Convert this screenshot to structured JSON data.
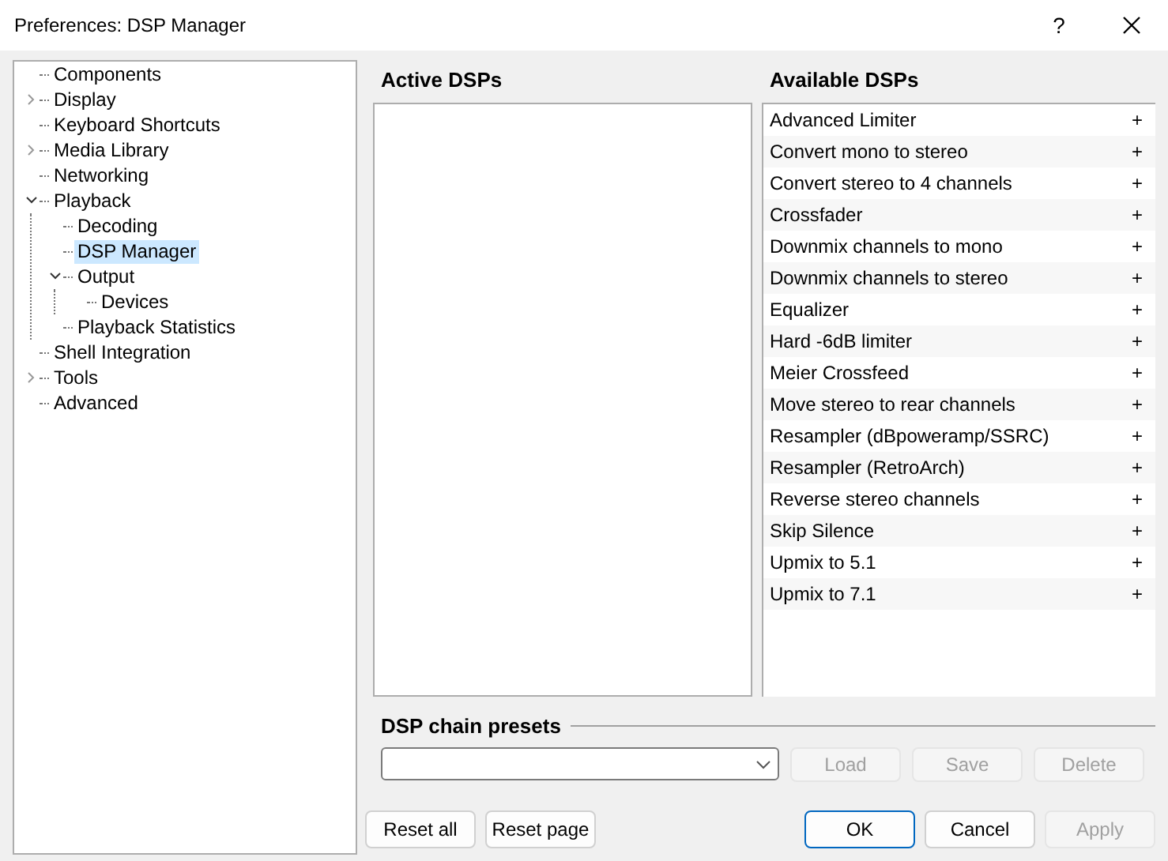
{
  "window": {
    "title": "Preferences: DSP Manager",
    "help": "?"
  },
  "tree": [
    {
      "label": "Components",
      "selected": false
    },
    {
      "label": "Display",
      "selected": false,
      "expanded": false
    },
    {
      "label": "Keyboard Shortcuts",
      "selected": false
    },
    {
      "label": "Media Library",
      "selected": false,
      "expanded": false
    },
    {
      "label": "Networking",
      "selected": false
    },
    {
      "label": "Playback",
      "selected": false,
      "expanded": true,
      "children": [
        {
          "label": "Decoding",
          "selected": false
        },
        {
          "label": "DSP Manager",
          "selected": true
        },
        {
          "label": "Output",
          "selected": false,
          "expanded": true,
          "children": [
            {
              "label": "Devices",
              "selected": false
            }
          ]
        },
        {
          "label": "Playback Statistics",
          "selected": false
        }
      ]
    },
    {
      "label": "Shell Integration",
      "selected": false
    },
    {
      "label": "Tools",
      "selected": false,
      "expanded": false
    },
    {
      "label": "Advanced",
      "selected": false
    }
  ],
  "active_dsps": {
    "title": "Active DSPs"
  },
  "available_dsps": {
    "title": "Available DSPs",
    "items": [
      {
        "label": "Advanced Limiter",
        "action": "+"
      },
      {
        "label": "Convert mono to stereo",
        "action": "+"
      },
      {
        "label": "Convert stereo to 4 channels",
        "action": "+"
      },
      {
        "label": "Crossfader",
        "action": "+"
      },
      {
        "label": "Downmix channels to mono",
        "action": "+"
      },
      {
        "label": "Downmix channels to stereo",
        "action": "+"
      },
      {
        "label": "Equalizer",
        "action": "+"
      },
      {
        "label": "Hard -6dB limiter",
        "action": "+"
      },
      {
        "label": "Meier Crossfeed",
        "action": "+"
      },
      {
        "label": "Move stereo to rear channels",
        "action": "+"
      },
      {
        "label": "Resampler (dBpoweramp/SSRC)",
        "action": "+"
      },
      {
        "label": "Resampler (RetroArch)",
        "action": "+"
      },
      {
        "label": "Reverse stereo channels",
        "action": "+"
      },
      {
        "label": "Skip Silence",
        "action": "+"
      },
      {
        "label": "Upmix to 5.1",
        "action": "+"
      },
      {
        "label": "Upmix to 7.1",
        "action": "+"
      }
    ]
  },
  "presets": {
    "title": "DSP chain presets",
    "buttons": [
      {
        "label": "Load",
        "disabled": true
      },
      {
        "label": "Save",
        "disabled": true
      },
      {
        "label": "Delete",
        "disabled": true
      }
    ]
  },
  "footer_left": [
    {
      "label": "Reset all",
      "disabled": false
    },
    {
      "label": "Reset page",
      "disabled": false
    }
  ],
  "footer_right": [
    {
      "label": "OK",
      "disabled": false,
      "default": true
    },
    {
      "label": "Cancel",
      "disabled": false,
      "default": false
    },
    {
      "label": "Apply",
      "disabled": true,
      "default": false
    }
  ]
}
